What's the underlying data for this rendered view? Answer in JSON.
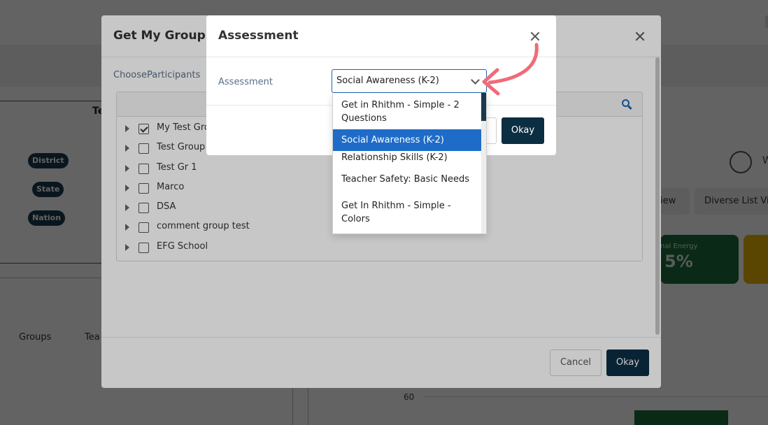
{
  "background": {
    "left_card_title": "Te",
    "pills": [
      "District",
      "State",
      "Nation"
    ],
    "tabs": [
      "Groups",
      "Tea"
    ],
    "axis_tick": "60",
    "right_buttons": [
      "iew",
      "Diverse List Vie"
    ],
    "sync_letter": "W",
    "tile": {
      "label": "nal Energy",
      "value": "5%"
    }
  },
  "modal_group": {
    "title": "Get My Group In",
    "choose_label": "ChooseParticipants",
    "tree_items": [
      {
        "label": "My Test Gro",
        "checked": true
      },
      {
        "label": "Test Group",
        "checked": false
      },
      {
        "label": "Test Gr 1",
        "checked": false
      },
      {
        "label": "Marco",
        "checked": false
      },
      {
        "label": "DSA",
        "checked": false
      },
      {
        "label": "comment group test",
        "checked": false
      },
      {
        "label": "EFG School",
        "checked": false
      }
    ],
    "cancel_label": "Cancel",
    "okay_label": "Okay"
  },
  "modal_assessment": {
    "title": "Assessment",
    "field_label": "Assessment",
    "selected_value": "Social Awareness (K-2)",
    "okay_label": "Okay",
    "options": [
      {
        "label": "Get in Rhithm - Simple - 2 Questions",
        "selected": false
      },
      {
        "label": "Social Awareness (K-2)",
        "selected": true
      },
      {
        "label": "Relationship Skills (K-2)",
        "selected": false
      },
      {
        "label": "Teacher Safety: Basic Needs",
        "selected": false
      },
      {
        "label": "Get In Rhithm - Simple - Colors",
        "selected": false
      }
    ]
  },
  "colors": {
    "primary_button": "#0b2e42",
    "option_highlight": "#1e6cc8",
    "annotation_arrow": "#f06a78",
    "tile_green": "#1d6b3a",
    "tile_yellow": "#e8b400"
  }
}
